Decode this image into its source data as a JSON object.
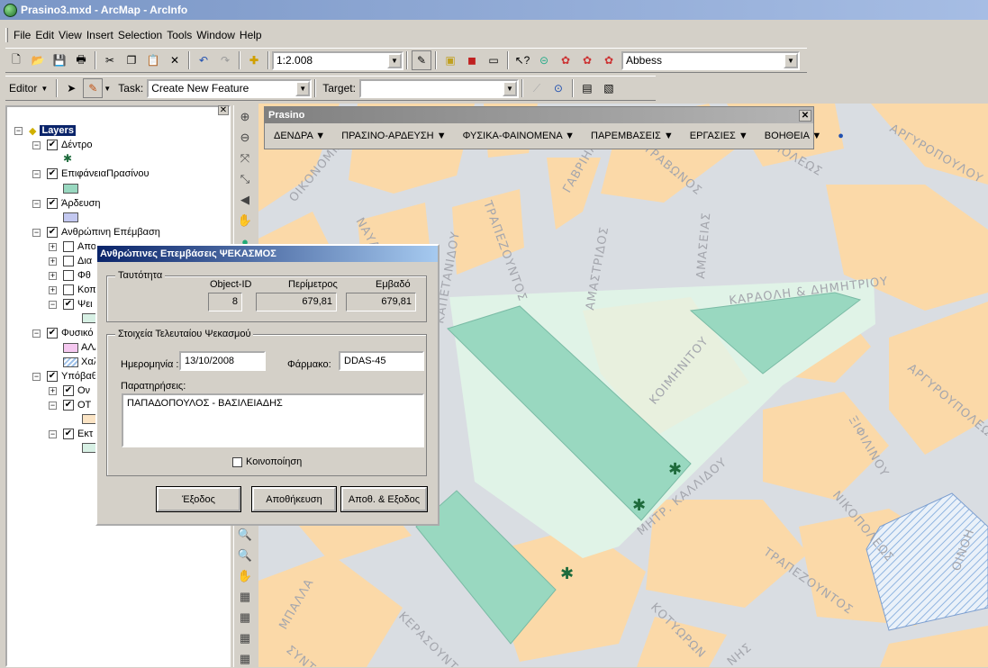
{
  "window": {
    "title": "Prasino3.mxd - ArcMap - ArcInfo"
  },
  "menus": [
    "File",
    "Edit",
    "View",
    "Insert",
    "Selection",
    "Tools",
    "Window",
    "Help"
  ],
  "standard_toolbar": {
    "scale": "1:2.008",
    "layer_combo": "Abbess"
  },
  "editor_toolbar": {
    "editor_label": "Editor",
    "task_label": "Task:",
    "task_value": "Create New Feature",
    "target_label": "Target:",
    "target_value": ""
  },
  "toc": {
    "root": "Layers",
    "items": [
      {
        "label": "Δέντρο",
        "checked": true
      },
      {
        "label": "ΕπιφάνειαΠρασίνου",
        "checked": true
      },
      {
        "label": "Άρδευση",
        "checked": true
      },
      {
        "label": "Ανθρώπινη Επέμβαση",
        "checked": true
      },
      {
        "label": "Απο",
        "checked": false
      },
      {
        "label": "Δια",
        "checked": false
      },
      {
        "label": "Φθ",
        "checked": false
      },
      {
        "label": "Κοπ",
        "checked": false
      },
      {
        "label": "Ψει",
        "checked": true
      },
      {
        "label": "Φυσικό",
        "checked": true
      },
      {
        "label": "ΑΛΛ",
        "checked": false
      },
      {
        "label": "Χαλ",
        "checked": false
      },
      {
        "label": "Υπόβαθ",
        "checked": true
      },
      {
        "label": "Ον",
        "checked": true
      },
      {
        "label": "ΟΤ",
        "checked": true
      },
      {
        "label": "Εκτ",
        "checked": true
      }
    ]
  },
  "prasino_toolbar": {
    "title": "Prasino",
    "menus": [
      "ΔΕΝΔΡΑ",
      "ΠΡΑΣΙΝΟ-ΑΡΔΕΥΣΗ",
      "ΦΥΣΙΚΑ-ΦΑΙΝΟΜΕΝΑ",
      "ΠΑΡΕΜΒΑΣΕΙΣ",
      "ΕΡΓΑΣΙΕΣ",
      "ΒΟΗΘΕΙΑ"
    ]
  },
  "dialog": {
    "title": "Ανθρώπινες Επεμβάσεις ΨΕΚΑΣΜΟΣ",
    "identity_group": "Ταυτότητα",
    "col_headers": [
      "Object-ID",
      "Περίμετρος",
      "Εμβαδό"
    ],
    "col_values": [
      "8",
      "679,81",
      "679,81"
    ],
    "last_group": "Στοιχεία Τελευταίου Ψεκασμού",
    "date_label": "Ημερομηνία :",
    "date_value": "13/10/2008",
    "drug_label": "Φάρμακο:",
    "drug_value": "DDAS-45",
    "notes_label": "Παρατηρήσεις:",
    "notes_value": "ΠΑΠΑΔΟΠΟΥΛΟΣ - ΒΑΣΙΛΕΙΑΔΗΣ",
    "notify_label": "Κοινοποίηση",
    "buttons": [
      "Έξοδος",
      "Αποθήκευση",
      "Αποθ. & Εξοδος"
    ]
  },
  "map": {
    "streets": [
      "ΟΙΚΟΝΟΜΙΔΗ",
      "ΝΑΥΑΡΙ",
      "ΚΑΠΕΤΑΝΙΔΟΥ",
      "ΤΡΑΠΕΖΟΥΝΤΟΣ",
      "ΑΜΑΣΤΡΙΔΟΣ",
      "ΓΑΒΡΙΗΛ",
      "ΣΤΡΑΒΩΝΟΣ",
      "ΑΜΑΣΕΙΑΣ",
      "ΠΟΛΕΩΣ",
      "ΑΡΓΥΡΟΠΟΥΛΟΥ",
      "ΚΑΡΑΟΛΗ & ΔΗΜΗΤΡΙΟΥ",
      "ΚΟΙΜΗΝΙΤΟΥ",
      "ΑΡΓΥΡΟΥΠΟΛΕΩΣ",
      "ΞΙΦΙΛΙΝΟΥ",
      "ΜΗΤΡ. ΚΑΛΛΙΔΟΥ",
      "ΝΙΚΟΠΟΛΕΩΣ",
      "ΟΙΝΟΗ",
      "ΤΡΑΠΕΖΟΥΝΤΟΣ",
      "ΚΟΤΥΩΡΩΝ",
      "ΚΕΡΑΣΟΥΝΤ",
      "ΜΠΑΛΛΑ",
      "ΣΥΝΤ.",
      "ΝΗΣ"
    ]
  },
  "colors": {
    "block": "#fbd9a8",
    "green_area": "#99d8c0",
    "light_green": "#e0f3e7",
    "tree": "#1e6b3c"
  }
}
